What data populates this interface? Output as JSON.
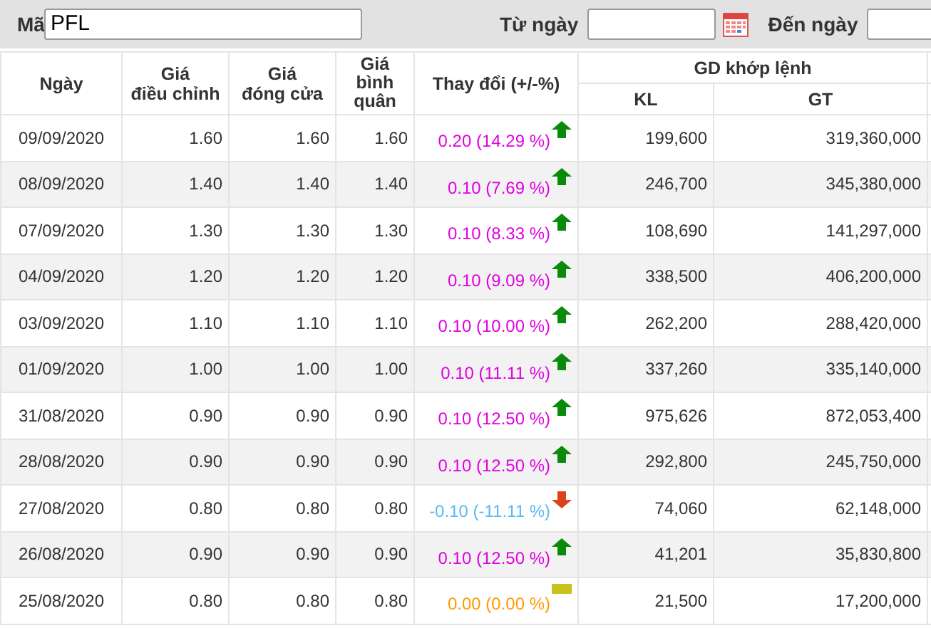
{
  "filter": {
    "code_label": "Mã",
    "code_value": "PFL",
    "from_label": "Từ ngày",
    "to_label": "Đến ngày"
  },
  "columns": [
    "Ngày",
    "Giá\nđiều chỉnh",
    "Giá\nđóng cửa",
    "Giá\nbình\nquân",
    "Thay đổi (+/-%)",
    "GD khớp lệnh",
    "KL",
    "GT"
  ],
  "rows": [
    {
      "date": "09/09/2020",
      "adjusted": "1.60",
      "close": "1.60",
      "average": "1.60",
      "change": "0.20 (14.29 %)",
      "kind": "up",
      "volume": "199,600",
      "value": "319,360,000"
    },
    {
      "date": "08/09/2020",
      "adjusted": "1.40",
      "close": "1.40",
      "average": "1.40",
      "change": "0.10 (7.69 %)",
      "kind": "up",
      "volume": "246,700",
      "value": "345,380,000"
    },
    {
      "date": "07/09/2020",
      "adjusted": "1.30",
      "close": "1.30",
      "average": "1.30",
      "change": "0.10 (8.33 %)",
      "kind": "up",
      "volume": "108,690",
      "value": "141,297,000"
    },
    {
      "date": "04/09/2020",
      "adjusted": "1.20",
      "close": "1.20",
      "average": "1.20",
      "change": "0.10 (9.09 %)",
      "kind": "up",
      "volume": "338,500",
      "value": "406,200,000"
    },
    {
      "date": "03/09/2020",
      "adjusted": "1.10",
      "close": "1.10",
      "average": "1.10",
      "change": "0.10 (10.00 %)",
      "kind": "up",
      "volume": "262,200",
      "value": "288,420,000"
    },
    {
      "date": "01/09/2020",
      "adjusted": "1.00",
      "close": "1.00",
      "average": "1.00",
      "change": "0.10 (11.11 %)",
      "kind": "up",
      "volume": "337,260",
      "value": "335,140,000"
    },
    {
      "date": "31/08/2020",
      "adjusted": "0.90",
      "close": "0.90",
      "average": "0.90",
      "change": "0.10 (12.50 %)",
      "kind": "up",
      "volume": "975,626",
      "value": "872,053,400"
    },
    {
      "date": "28/08/2020",
      "adjusted": "0.90",
      "close": "0.90",
      "average": "0.90",
      "change": "0.10 (12.50 %)",
      "kind": "up",
      "volume": "292,800",
      "value": "245,750,000"
    },
    {
      "date": "27/08/2020",
      "adjusted": "0.80",
      "close": "0.80",
      "average": "0.80",
      "change": "-0.10 (-11.11 %)",
      "kind": "down",
      "volume": "74,060",
      "value": "62,148,000"
    },
    {
      "date": "26/08/2020",
      "adjusted": "0.90",
      "close": "0.90",
      "average": "0.90",
      "change": "0.10 (12.50 %)",
      "kind": "up",
      "volume": "41,201",
      "value": "35,830,800"
    },
    {
      "date": "25/08/2020",
      "adjusted": "0.80",
      "close": "0.80",
      "average": "0.80",
      "change": "0.00 (0.00 %)",
      "kind": "flat",
      "volume": "21,500",
      "value": "17,200,000"
    }
  ]
}
